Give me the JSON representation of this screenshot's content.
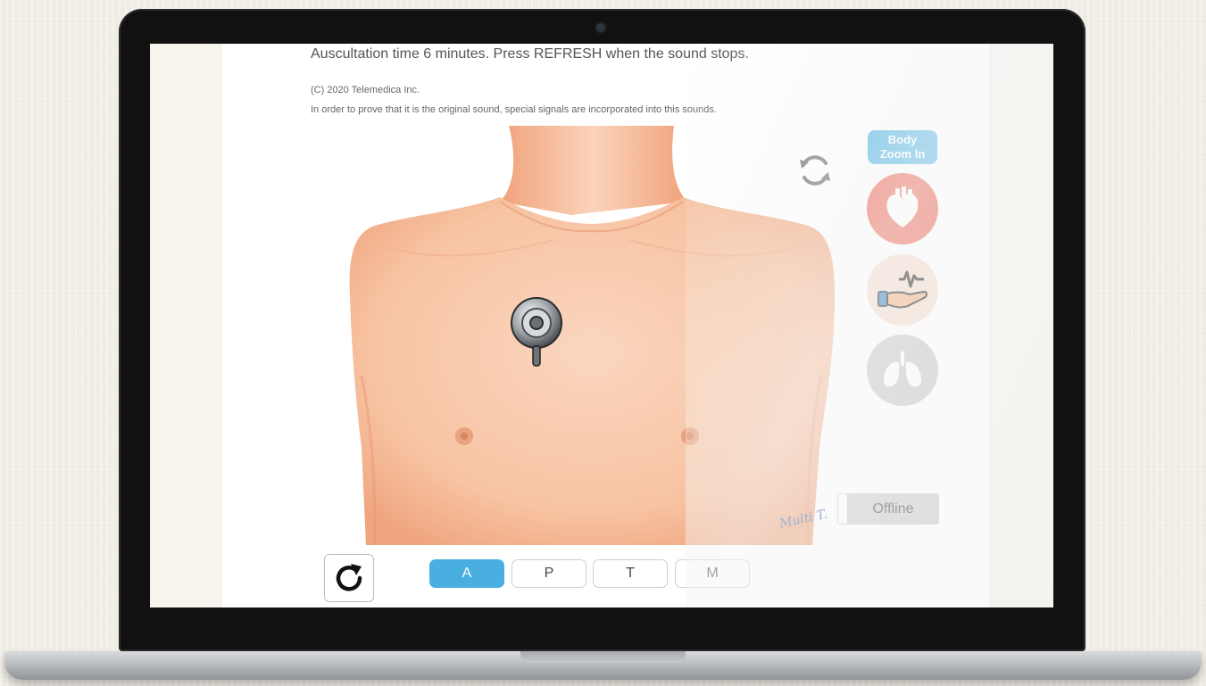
{
  "header": {
    "instruction": "Auscultation time 6 minutes. Press REFRESH when the sound stops.",
    "copyright": "(C) 2020 Telemedica Inc.",
    "notice": "In order to prove that it is the original sound, special signals are incorporated into this sounds."
  },
  "artwork": {
    "signature": "Multi T."
  },
  "side_panel": {
    "body_zoom_label_line1": "Body",
    "body_zoom_label_line2": "Zoom In",
    "buttons": [
      {
        "name": "heart",
        "icon": "heart-icon",
        "color": "#ec6b5a"
      },
      {
        "name": "pulse",
        "icon": "hand-pulse-icon",
        "color": "#f6dfcf"
      },
      {
        "name": "lungs",
        "icon": "lungs-icon",
        "color": "#c9c9c9"
      }
    ]
  },
  "status": {
    "offline_label": "Offline"
  },
  "tabs": [
    {
      "label": "A",
      "active": true
    },
    {
      "label": "P",
      "active": false
    },
    {
      "label": "T",
      "active": false
    },
    {
      "label": "M",
      "active": false
    }
  ],
  "colors": {
    "accent": "#49aee0",
    "heart": "#ec6b5a",
    "skin": "#f7c8a8"
  }
}
